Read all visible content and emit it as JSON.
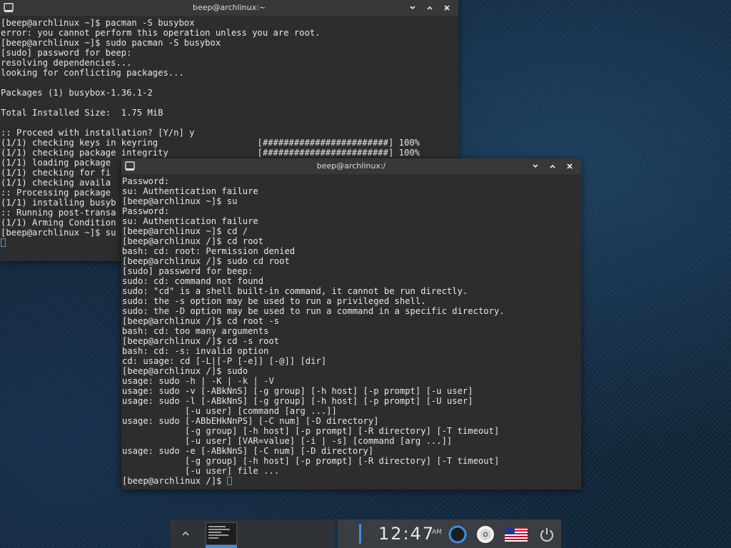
{
  "windows": [
    {
      "title": "beep@archlinux:~",
      "controls": {
        "minimize": "⌄",
        "maximize": "⌃",
        "close": "✕"
      },
      "lines": [
        "[beep@archlinux ~]$ pacman -S busybox",
        "error: you cannot perform this operation unless you are root.",
        "[beep@archlinux ~]$ sudo pacman -S busybox",
        "[sudo] password for beep:",
        "resolving dependencies...",
        "looking for conflicting packages...",
        "",
        "Packages (1) busybox-1.36.1-2",
        "",
        "Total Installed Size:  1.75 MiB",
        "",
        ":: Proceed with installation? [Y/n] y",
        "(1/1) checking keys in keyring                   [########################] 100%",
        "(1/1) checking package integrity                 [########################] 100%",
        "(1/1) loading package",
        "(1/1) checking for fi",
        "(1/1) checking availa",
        ":: Processing package",
        "(1/1) installing busyb",
        ":: Running post-transa",
        "(1/1) Arming Condition",
        "[beep@archlinux ~]$ su",
        ""
      ]
    },
    {
      "title": "beep@archlinux:/",
      "controls": {
        "minimize": "⌄",
        "maximize": "⌃",
        "close": "✕"
      },
      "lines": [
        "Password:",
        "su: Authentication failure",
        "[beep@archlinux ~]$ su",
        "Password:",
        "su: Authentication failure",
        "[beep@archlinux ~]$ cd /",
        "[beep@archlinux /]$ cd root",
        "bash: cd: root: Permission denied",
        "[beep@archlinux /]$ sudo cd root",
        "[sudo] password for beep:",
        "sudo: cd: command not found",
        "sudo: \"cd\" is a shell built-in command, it cannot be run directly.",
        "sudo: the -s option may be used to run a privileged shell.",
        "sudo: the -D option may be used to run a command in a specific directory.",
        "[beep@archlinux /]$ cd root -s",
        "bash: cd: too many arguments",
        "[beep@archlinux /]$ cd -s root",
        "bash: cd: -s: invalid option",
        "cd: usage: cd [-L|[-P [-e]] [-@]] [dir]",
        "[beep@archlinux /]$ sudo",
        "usage: sudo -h | -K | -k | -V",
        "usage: sudo -v [-ABkNnS] [-g group] [-h host] [-p prompt] [-u user]",
        "usage: sudo -l [-ABkNnS] [-g group] [-h host] [-p prompt] [-U user]",
        "            [-u user] [command [arg ...]]",
        "usage: sudo [-ABbEHkNnPS] [-C num] [-D directory]",
        "            [-g group] [-h host] [-p prompt] [-R directory] [-T timeout]",
        "            [-u user] [VAR=value] [-i | -s] [command [arg ...]]",
        "usage: sudo -e [-ABkNnS] [-C num] [-D directory]",
        "            [-g group] [-h host] [-p prompt] [-R directory] [-T timeout]",
        "            [-u user] file ...",
        "[beep@archlinux /]$ "
      ]
    }
  ],
  "taskbar": {
    "clock": "12:47",
    "ampm": "AM",
    "accent_color": "#3d8fe0",
    "icons": [
      "chevron-up-icon",
      "terminal-thumbnail",
      "circle-ring-icon",
      "cd-drive-icon",
      "us-flag-icon",
      "power-icon"
    ]
  }
}
